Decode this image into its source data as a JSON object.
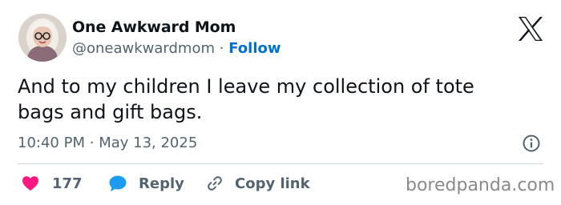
{
  "author": {
    "display_name": "One Awkward Mom",
    "handle": "@oneawkwardmom",
    "separator": "·",
    "follow_label": "Follow"
  },
  "tweet": {
    "text_line1": "And to my children I leave my collection of tote",
    "text_line2": "bags and gift bags.",
    "time": "10:40 PM",
    "date_separator": "·",
    "date": "May 13, 2025"
  },
  "actions": {
    "like_count": "177",
    "reply_label": "Reply",
    "copy_label": "Copy link"
  },
  "watermark": "boredpanda.com",
  "icons": {
    "brand": "x-logo-icon",
    "info": "info-icon",
    "like": "heart-icon",
    "reply": "reply-bubble-icon",
    "copy": "link-icon"
  },
  "colors": {
    "follow": "#006fd6",
    "heart": "#f91880",
    "reply": "#1d9bf0",
    "secondary_text": "#536471"
  }
}
